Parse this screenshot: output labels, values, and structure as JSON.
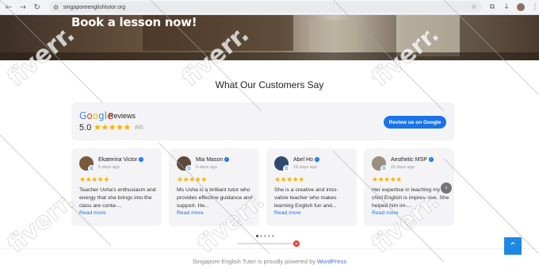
{
  "browser": {
    "back_icon": "arrow-left-icon",
    "forward_icon": "arrow-right-icon",
    "reload_icon": "reload-icon",
    "url": "singaporeenglishtutor.org"
  },
  "hero": {
    "title": "Book a lesson now!"
  },
  "section": {
    "title": "What Our Customers Say"
  },
  "google": {
    "logo": [
      "G",
      "o",
      "o",
      "g",
      "l",
      "e"
    ],
    "reviews_label": "Reviews",
    "rating": "5.0",
    "stars": "★★★★★",
    "count": "(62)",
    "review_button": "Review us on Google"
  },
  "reviews": [
    {
      "name": "Ekaterina Victor",
      "date": "5 days ago",
      "stars": "★★★★★",
      "text": "Teacher Usha's enthusiasm and energy that she brings into the class are conta-...",
      "more": "Read more",
      "avatar_color": "#7a5a3a"
    },
    {
      "name": "Mia Mason",
      "date": "5 days ago",
      "stars": "★★★★★",
      "text": "Ms Usha is a brilliant tutor who provides effective guidance and support. He...",
      "more": "Read more",
      "avatar_color": "#5d4a3b"
    },
    {
      "name": "Abel Ho",
      "date": "19 days ago",
      "stars": "★★★★★",
      "text": "She is a creative and inno-vative teacher who makes learning English fun and...",
      "more": "Read more",
      "avatar_color": "#2f4a6d"
    },
    {
      "name": "Aesthetic MSP",
      "date": "26 days ago",
      "stars": "★★★★★",
      "text": "Her expertise in teaching my child English is impres-sive. She helped him im-...",
      "more": "Read more",
      "avatar_color": "#9a8f80"
    }
  ],
  "footer": {
    "prefix": "Singapore English Tutor is proudly powered by ",
    "link": "WordPress"
  },
  "watermark_text": "fiverr."
}
